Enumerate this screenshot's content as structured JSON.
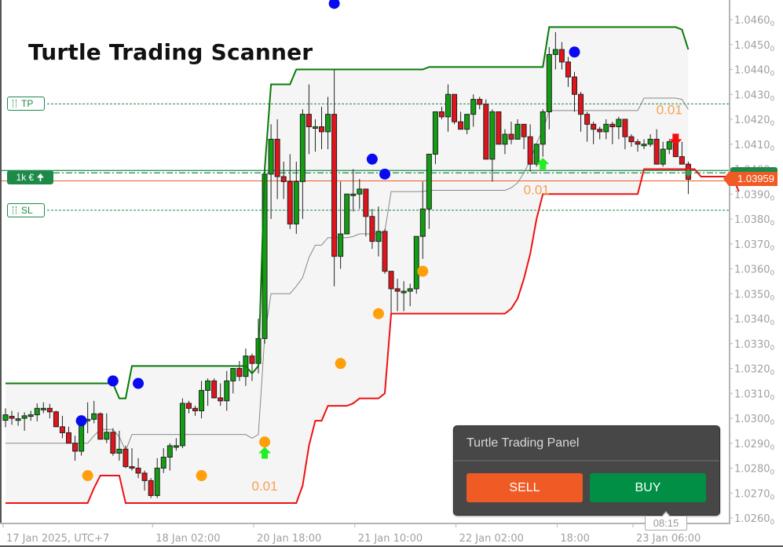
{
  "title": "Turtle Trading Scanner",
  "colors": {
    "bull": "#119e11",
    "bear": "#e0141a",
    "upper_channel": "#087a08",
    "lower_channel": "#ee1111",
    "mid_line": "#888888",
    "signal_blue": "#0a0af0",
    "signal_orange": "#ffa00a",
    "arrow_up": "#22ee22",
    "arrow_down": "#f01010",
    "level_green": "#1e8a4a",
    "price_orange": "#f05a24",
    "axis": "#b4b4b4",
    "axis_text": "#a0a0a0"
  },
  "levels": {
    "tp": {
      "label": "TP",
      "price": 1.04262
    },
    "sl": {
      "label": "SL",
      "price": 1.03835
    },
    "position": {
      "label": "1k € 🠉",
      "price": 1.03985
    }
  },
  "current_price": {
    "label": "1.03959",
    "price": 1.03959
  },
  "panel": {
    "title": "Turtle Trading Panel",
    "sell_label": "SELL",
    "buy_label": "BUY"
  },
  "crosshair_time": "08:15",
  "chart_data": {
    "type": "candlestick",
    "title": "Turtle Trading Scanner",
    "ylim": [
      1.0256,
      1.0468
    ],
    "y_ticks": [
      1.026,
      1.027,
      1.028,
      1.029,
      1.03,
      1.031,
      1.032,
      1.033,
      1.034,
      1.035,
      1.036,
      1.037,
      1.038,
      1.039,
      1.04,
      1.041,
      1.042,
      1.043,
      1.044,
      1.045,
      1.046
    ],
    "y_tick_labels": [
      "1.02600",
      "1.02700",
      "1.02800",
      "1.02900",
      "1.03000",
      "1.03100",
      "1.03200",
      "1.03300",
      "1.03400",
      "1.03500",
      "1.03600",
      "1.03700",
      "1.03800",
      "1.03900",
      "1.04000",
      "1.04100",
      "1.04200",
      "1.04300",
      "1.04400",
      "1.04500",
      "1.04600"
    ],
    "x_tick_labels": [
      {
        "label": "17 Jan 2025, UTC+7",
        "bar": 0
      },
      {
        "label": "18 Jan 02:00",
        "bar": 24
      },
      {
        "label": "20 Jan 18:00",
        "bar": 40
      },
      {
        "label": "21 Jan 10:00",
        "bar": 56
      },
      {
        "label": "22 Jan 02:00",
        "bar": 72
      },
      {
        "label": "18:00",
        "bar": 88
      },
      {
        "label": "23 Jan 06:00",
        "bar": 100
      }
    ],
    "grid": false,
    "candles": [
      [
        1.02992,
        1.0304,
        1.02964,
        1.03014
      ],
      [
        1.03008,
        1.0303,
        1.02974,
        1.03
      ],
      [
        1.02996,
        1.03024,
        1.0297,
        1.02998
      ],
      [
        1.03,
        1.03024,
        1.0295,
        1.0301
      ],
      [
        1.0301,
        1.0303,
        1.0299,
        1.03014
      ],
      [
        1.03014,
        1.0306,
        1.02988,
        1.0304
      ],
      [
        1.0304,
        1.03064,
        1.0302,
        1.0304
      ],
      [
        1.0304,
        1.03058,
        1.03,
        1.03026
      ],
      [
        1.03026,
        1.0303,
        1.0298,
        1.02966
      ],
      [
        1.02966,
        1.0301,
        1.0292,
        1.02942
      ],
      [
        1.02942,
        1.02966,
        1.029,
        1.029
      ],
      [
        1.029,
        1.0293,
        1.0283,
        1.02868
      ],
      [
        1.02868,
        1.0299,
        1.0285,
        1.02996
      ],
      [
        1.02996,
        1.03064,
        1.0294,
        1.02996
      ],
      [
        1.02996,
        1.0307,
        1.0298,
        1.03018
      ],
      [
        1.03018,
        1.03024,
        1.0295,
        1.02916
      ],
      [
        1.02916,
        1.0302,
        1.029,
        1.02944
      ],
      [
        1.02944,
        1.0296,
        1.0285,
        1.0286
      ],
      [
        1.0286,
        1.0295,
        1.0283,
        1.02876
      ],
      [
        1.02876,
        1.0289,
        1.028,
        1.02806
      ],
      [
        1.02806,
        1.0288,
        1.0279,
        1.028
      ],
      [
        1.028,
        1.0284,
        1.0276,
        1.0278
      ],
      [
        1.0278,
        1.0279,
        1.0271,
        1.0275
      ],
      [
        1.0275,
        1.0276,
        1.0268,
        1.0269
      ],
      [
        1.0269,
        1.0284,
        1.0268,
        1.028
      ],
      [
        1.028,
        1.0288,
        1.0278,
        1.02844
      ],
      [
        1.02844,
        1.029,
        1.0279,
        1.0289
      ],
      [
        1.0289,
        1.0292,
        1.0287,
        1.0289
      ],
      [
        1.0289,
        1.0308,
        1.0288,
        1.0306
      ],
      [
        1.0306,
        1.0307,
        1.0302,
        1.0304
      ],
      [
        1.0304,
        1.0305,
        1.0301,
        1.0303
      ],
      [
        1.0303,
        1.0315,
        1.03,
        1.03112
      ],
      [
        1.03112,
        1.0316,
        1.0305,
        1.0315
      ],
      [
        1.0315,
        1.0316,
        1.0308,
        1.03082
      ],
      [
        1.03082,
        1.0314,
        1.0305,
        1.0307
      ],
      [
        1.0307,
        1.0319,
        1.0303,
        1.0315
      ],
      [
        1.0315,
        1.032,
        1.031,
        1.032
      ],
      [
        1.032,
        1.0323,
        1.0315,
        1.03168
      ],
      [
        1.03168,
        1.0328,
        1.0313,
        1.0325
      ],
      [
        1.0325,
        1.0326,
        1.0315,
        1.0322
      ],
      [
        1.0322,
        1.034,
        1.0318,
        1.0332
      ],
      [
        1.0332,
        1.04,
        1.033,
        1.0398
      ],
      [
        1.0398,
        1.0418,
        1.038,
        1.0412
      ],
      [
        1.0412,
        1.042,
        1.0388,
        1.0397
      ],
      [
        1.0397,
        1.0403,
        1.0388,
        1.0395
      ],
      [
        1.0395,
        1.0406,
        1.0376,
        1.0378
      ],
      [
        1.0378,
        1.0403,
        1.0374,
        1.0395
      ],
      [
        1.0395,
        1.0424,
        1.038,
        1.0422
      ],
      [
        1.0422,
        1.0434,
        1.0406,
        1.0417
      ],
      [
        1.0417,
        1.042,
        1.0407,
        1.0417
      ],
      [
        1.0417,
        1.0425,
        1.0408,
        1.0415
      ],
      [
        1.0415,
        1.0429,
        1.0408,
        1.0422
      ],
      [
        1.0422,
        1.044,
        1.0353,
        1.0365
      ],
      [
        1.0365,
        1.0395,
        1.036,
        1.0374
      ],
      [
        1.0374,
        1.0388,
        1.0382,
        1.039
      ],
      [
        1.039,
        1.04,
        1.0383,
        1.039
      ],
      [
        1.039,
        1.0396,
        1.0384,
        1.0392
      ],
      [
        1.0392,
        1.0392,
        1.0373,
        1.0381
      ],
      [
        1.0381,
        1.0384,
        1.0368,
        1.0371
      ],
      [
        1.0371,
        1.0385,
        1.0365,
        1.0375
      ],
      [
        1.0375,
        1.0376,
        1.0358,
        1.0359
      ],
      [
        1.0359,
        1.0359,
        1.0341,
        1.0352
      ],
      [
        1.0352,
        1.0356,
        1.0343,
        1.0351
      ],
      [
        1.0351,
        1.0355,
        1.0343,
        1.0351
      ],
      [
        1.0351,
        1.0354,
        1.0345,
        1.0352
      ],
      [
        1.0352,
        1.0373,
        1.035,
        1.0373
      ],
      [
        1.0373,
        1.0395,
        1.0364,
        1.0384
      ],
      [
        1.0384,
        1.04,
        1.0376,
        1.0406
      ],
      [
        1.0406,
        1.0422,
        1.0402,
        1.0423
      ],
      [
        1.0423,
        1.0425,
        1.042,
        1.0421
      ],
      [
        1.0421,
        1.0434,
        1.0415,
        1.043
      ],
      [
        1.043,
        1.043,
        1.0418,
        1.0419
      ],
      [
        1.0419,
        1.0423,
        1.0416,
        1.0416
      ],
      [
        1.0416,
        1.042,
        1.0414,
        1.0422
      ],
      [
        1.0422,
        1.043,
        1.0417,
        1.0428
      ],
      [
        1.0428,
        1.0429,
        1.0424,
        1.0426
      ],
      [
        1.0426,
        1.0428,
        1.0408,
        1.0404
      ],
      [
        1.0404,
        1.0424,
        1.0395,
        1.0423
      ],
      [
        1.0423,
        1.0423,
        1.041,
        1.041
      ],
      [
        1.041,
        1.0416,
        1.0406,
        1.0414
      ],
      [
        1.0414,
        1.0419,
        1.041,
        1.0412
      ],
      [
        1.0412,
        1.042,
        1.0412,
        1.0418
      ],
      [
        1.0418,
        1.0418,
        1.0408,
        1.0413
      ],
      [
        1.0413,
        1.0418,
        1.0399,
        1.0402
      ],
      [
        1.0402,
        1.041,
        1.0401,
        1.041
      ],
      [
        1.041,
        1.0424,
        1.0405,
        1.0423
      ],
      [
        1.0423,
        1.0449,
        1.0416,
        1.0446
      ],
      [
        1.0446,
        1.0455,
        1.044,
        1.0448
      ],
      [
        1.0448,
        1.0451,
        1.044,
        1.0443
      ],
      [
        1.0443,
        1.0445,
        1.0433,
        1.0437
      ],
      [
        1.0437,
        1.0439,
        1.0423,
        1.043
      ],
      [
        1.043,
        1.0431,
        1.0415,
        1.0422
      ],
      [
        1.0422,
        1.0423,
        1.0411,
        1.0418
      ],
      [
        1.0418,
        1.0419,
        1.041,
        1.0416
      ],
      [
        1.0416,
        1.0417,
        1.0412,
        1.0415
      ],
      [
        1.0415,
        1.042,
        1.0412,
        1.0418
      ],
      [
        1.0418,
        1.0419,
        1.041,
        1.0417
      ],
      [
        1.0417,
        1.0421,
        1.0412,
        1.042
      ],
      [
        1.042,
        1.042,
        1.0408,
        1.0413
      ],
      [
        1.0413,
        1.0414,
        1.0409,
        1.0411
      ],
      [
        1.0411,
        1.0412,
        1.0407,
        1.041
      ],
      [
        1.041,
        1.0412,
        1.0408,
        1.041
      ],
      [
        1.041,
        1.0414,
        1.0409,
        1.0412
      ],
      [
        1.0412,
        1.0416,
        1.0402,
        1.0402
      ],
      [
        1.0402,
        1.0411,
        1.0401,
        1.0408
      ],
      [
        1.0408,
        1.0412,
        1.0406,
        1.0411
      ],
      [
        1.0411,
        1.0413,
        1.0405,
        1.0405
      ],
      [
        1.0405,
        1.0411,
        1.0404,
        1.0402
      ],
      [
        1.0402,
        1.0403,
        1.039,
        1.03959
      ]
    ],
    "upper_channel": [
      1.0314,
      1.0314,
      1.0314,
      1.0314,
      1.0314,
      1.0314,
      1.0314,
      1.0314,
      1.0314,
      1.0314,
      1.0314,
      1.0314,
      1.0314,
      1.0314,
      1.0314,
      1.0314,
      1.0314,
      1.0314,
      1.0308,
      1.0308,
      1.0321,
      1.0321,
      1.0321,
      1.0321,
      1.0321,
      1.0321,
      1.0321,
      1.0321,
      1.0321,
      1.0321,
      1.0321,
      1.0321,
      1.0321,
      1.0321,
      1.0321,
      1.0321,
      1.0321,
      1.0321,
      1.0321,
      1.0318,
      1.0321,
      1.04,
      1.0434,
      1.0434,
      1.0434,
      1.0434,
      1.044,
      1.044,
      1.044,
      1.044,
      1.044,
      1.044,
      1.044,
      1.044,
      1.044,
      1.044,
      1.044,
      1.044,
      1.044,
      1.044,
      1.044,
      1.044,
      1.044,
      1.044,
      1.044,
      1.044,
      1.044,
      1.0441,
      1.0441,
      1.0441,
      1.0441,
      1.0441,
      1.0441,
      1.0441,
      1.0441,
      1.0441,
      1.0441,
      1.0441,
      1.0441,
      1.0441,
      1.0441,
      1.0441,
      1.0441,
      1.0441,
      1.0441,
      1.0441,
      1.0457,
      1.0457,
      1.0457,
      1.0457,
      1.0457,
      1.0457,
      1.0457,
      1.0457,
      1.0457,
      1.0457,
      1.0457,
      1.0457,
      1.0457,
      1.0457,
      1.0457,
      1.0457,
      1.0457,
      1.0457,
      1.0457,
      1.0457,
      1.0457,
      1.0456,
      1.0448
    ],
    "lower_channel": [
      1.0266,
      1.0266,
      1.0266,
      1.0266,
      1.0266,
      1.0266,
      1.0266,
      1.0266,
      1.0266,
      1.0266,
      1.0266,
      1.0266,
      1.0266,
      1.0266,
      1.0272,
      1.0277,
      1.0277,
      1.0277,
      1.0277,
      1.0266,
      1.0266,
      1.0266,
      1.0266,
      1.0266,
      1.0266,
      1.0266,
      1.0266,
      1.0266,
      1.0266,
      1.0266,
      1.0266,
      1.0266,
      1.0266,
      1.0266,
      1.0266,
      1.0266,
      1.0266,
      1.0266,
      1.0266,
      1.0266,
      1.0266,
      1.0266,
      1.0266,
      1.0266,
      1.0266,
      1.0266,
      1.0266,
      1.0273,
      1.0289,
      1.0299,
      1.0299,
      1.0305,
      1.0305,
      1.0305,
      1.0305,
      1.0306,
      1.0308,
      1.0308,
      1.0308,
      1.0308,
      1.031,
      1.0342,
      1.0342,
      1.0342,
      1.0342,
      1.0342,
      1.0342,
      1.0342,
      1.0342,
      1.0342,
      1.0342,
      1.0342,
      1.0342,
      1.0342,
      1.0342,
      1.0342,
      1.0342,
      1.0342,
      1.0342,
      1.0342,
      1.0344,
      1.0348,
      1.0356,
      1.0366,
      1.038,
      1.039,
      1.039,
      1.039,
      1.039,
      1.039,
      1.039,
      1.039,
      1.039,
      1.039,
      1.039,
      1.039,
      1.039,
      1.039,
      1.039,
      1.039,
      1.039,
      1.04,
      1.04,
      1.04,
      1.04,
      1.04,
      1.04,
      1.04,
      1.04,
      1.04,
      1.0397,
      1.0397,
      1.0397,
      1.0397,
      1.0397,
      1.0397,
      1.0391
    ],
    "signals": [
      {
        "type": "dot",
        "color": "blue",
        "bar": 12,
        "price": 1.0299
      },
      {
        "type": "dot",
        "color": "blue",
        "bar": 17,
        "price": 1.0315
      },
      {
        "type": "dot",
        "color": "blue",
        "bar": 21,
        "price": 1.0314
      },
      {
        "type": "dot",
        "color": "orange",
        "bar": 13,
        "price": 1.0277
      },
      {
        "type": "dot",
        "color": "orange",
        "bar": 31,
        "price": 1.0277
      },
      {
        "type": "dot",
        "color": "orange",
        "bar": 41,
        "price": 1.02905
      },
      {
        "type": "dot",
        "color": "orange",
        "bar": 53,
        "price": 1.0322
      },
      {
        "type": "dot",
        "color": "orange",
        "bar": 59,
        "price": 1.0342
      },
      {
        "type": "dot",
        "color": "orange",
        "bar": 66,
        "price": 1.0359
      },
      {
        "type": "dot",
        "color": "blue",
        "bar": 52,
        "price": 1.04665
      },
      {
        "type": "dot",
        "color": "blue",
        "bar": 58,
        "price": 1.0404
      },
      {
        "type": "dot",
        "color": "blue",
        "bar": 60,
        "price": 1.0398
      },
      {
        "type": "dot",
        "color": "blue",
        "bar": 90,
        "price": 1.0447
      },
      {
        "type": "arrow_up",
        "bar": 41,
        "price": 1.0286
      },
      {
        "type": "arrow_up",
        "bar": 85,
        "price": 1.0402
      },
      {
        "type": "arrow_down",
        "bar": 106,
        "price": 1.0412
      }
    ],
    "annotations": [
      {
        "text": "0.01",
        "bar": 41,
        "price": 1.0271
      },
      {
        "text": "0.01",
        "bar": 84,
        "price": 1.039
      },
      {
        "text": "0.01",
        "bar": 105,
        "price": 1.0422
      }
    ]
  }
}
